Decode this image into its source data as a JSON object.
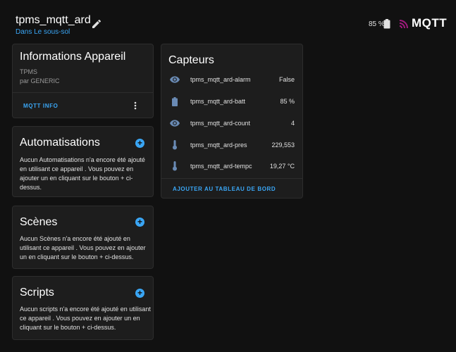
{
  "header": {
    "title": "tpms_mqtt_ard",
    "area": "Dans Le sous-sol",
    "battery_pct": "85 %",
    "logo_text": "MQTT"
  },
  "info_card": {
    "title": "Informations Appareil",
    "model": "TPMS",
    "manufacturer": "par GENERIC",
    "action": "MQTT INFO"
  },
  "automations": {
    "title": "Automatisations",
    "text": "Aucun Automatisations n'a encore été ajouté en utilisant ce appareil . Vous pouvez en ajouter un en cliquant sur le bouton + ci-dessus."
  },
  "scenes": {
    "title": "Scènes",
    "text": "Aucun Scènes n'a encore été ajouté en utilisant ce appareil . Vous pouvez en ajouter un en cliquant sur le bouton + ci-dessus."
  },
  "scripts": {
    "title": "Scripts",
    "text": "Aucun scripts n'a encore été ajouté en utilisant ce appareil . Vous pouvez en ajouter un en cliquant sur le bouton + ci-dessus."
  },
  "sensors": {
    "title": "Capteurs",
    "items": [
      {
        "name": "tpms_mqtt_ard-alarm",
        "value": "False",
        "icon": "eye-icon"
      },
      {
        "name": "tpms_mqtt_ard-batt",
        "value": "85 %",
        "icon": "battery-icon"
      },
      {
        "name": "tpms_mqtt_ard-count",
        "value": "4",
        "icon": "eye-icon"
      },
      {
        "name": "tpms_mqtt_ard-pres",
        "value": "229,553",
        "icon": "thermometer-icon"
      },
      {
        "name": "tpms_mqtt_ard-tempc",
        "value": "19,27 °C",
        "icon": "thermometer-icon"
      }
    ],
    "action": "AJOUTER AU TABLEAU DE BORD"
  },
  "colors": {
    "accent": "#3aa6f5",
    "icon": "#6a8bb5",
    "background": "#111111",
    "card": "#1d1d1d"
  }
}
